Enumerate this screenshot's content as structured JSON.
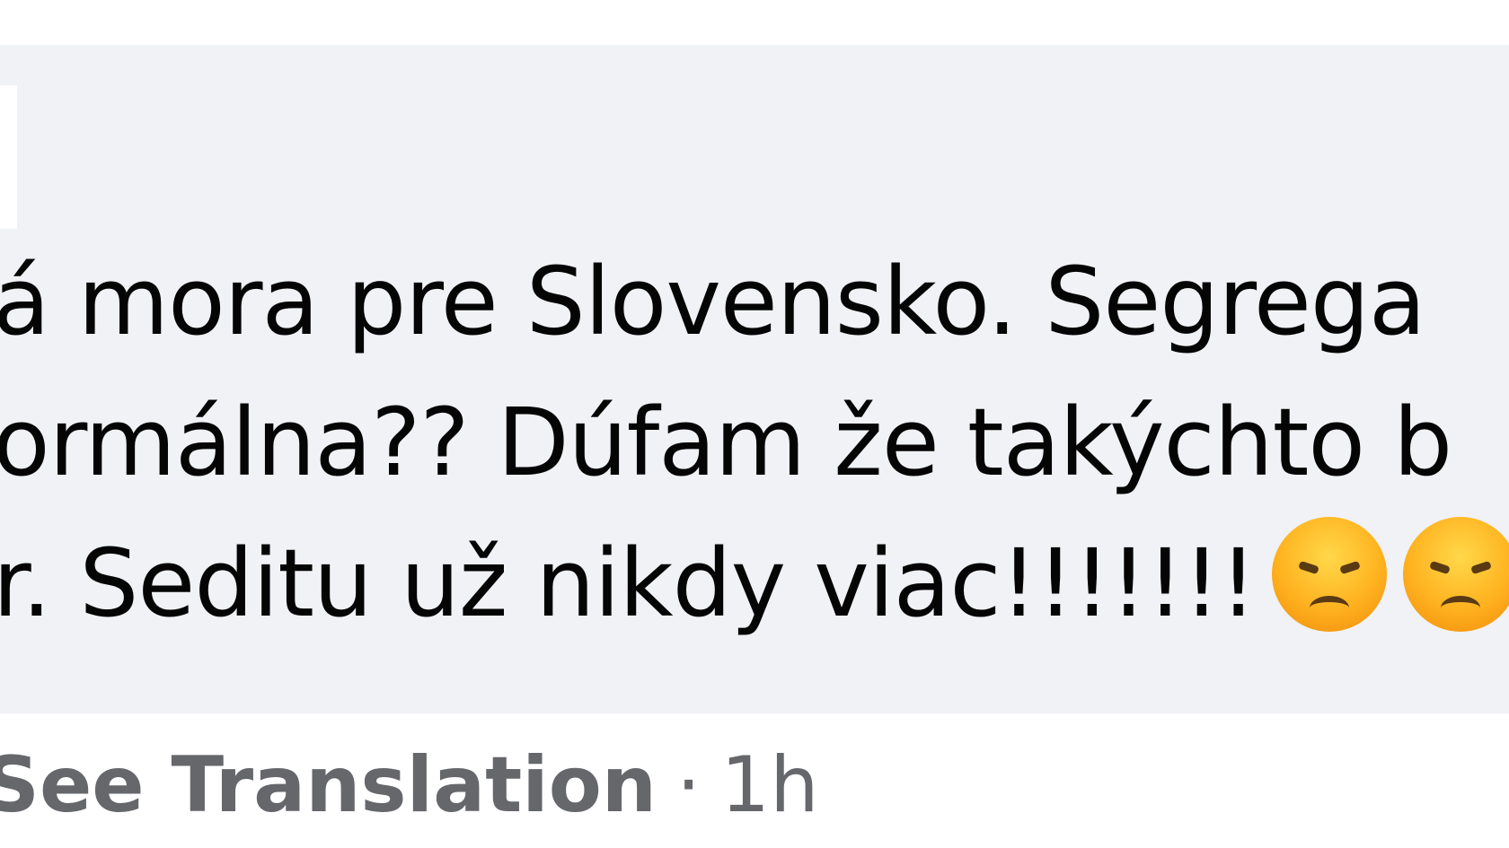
{
  "comment": {
    "lines": [
      "á mora pre Slovensko. Segrega",
      "ormálna?? Dúfam že takýchto b",
      "r. Seditu už nikdy viac!!!!!!!"
    ],
    "emojis": [
      "angry-face-icon",
      "angry-face-icon"
    ]
  },
  "footer": {
    "see_translation": "See Translation",
    "separator": "·",
    "timestamp": "1h"
  },
  "colors": {
    "bubble_background": "#f0f2f5",
    "text": "#050505",
    "secondary_text": "#65676b",
    "emoji_yellow": "#ffc62e"
  }
}
